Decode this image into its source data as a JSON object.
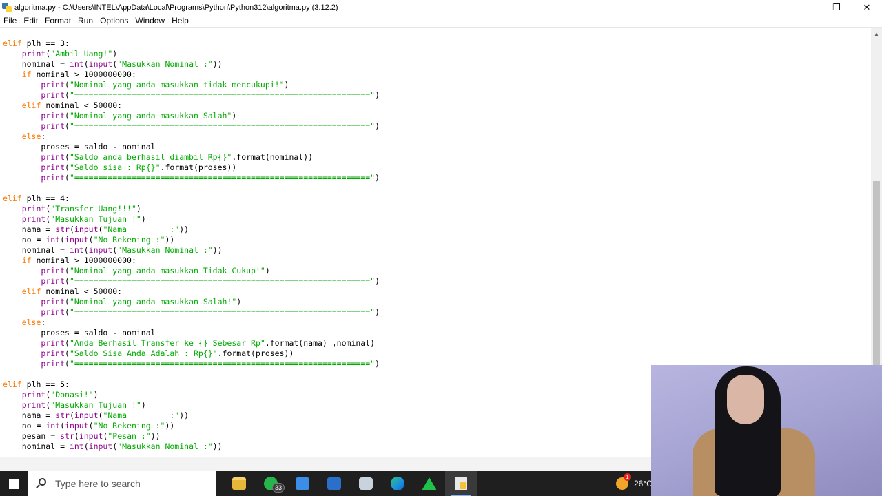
{
  "window": {
    "title": "algoritma.py - C:\\Users\\INTEL\\AppData\\Local\\Programs\\Python\\Python312\\algoritma.py (3.12.2)",
    "controls": {
      "minimize": "—",
      "restore": "❐",
      "close": "✕"
    }
  },
  "menu": {
    "items": [
      "File",
      "Edit",
      "Format",
      "Run",
      "Options",
      "Window",
      "Help"
    ]
  },
  "editor": {
    "language": "python",
    "colors": {
      "keyword": "#ff7700",
      "builtin": "#900090",
      "string": "#00aa00",
      "text": "#000000"
    },
    "lines": [
      "elif plh == 3:",
      "    print(\"Ambil Uang!\")",
      "    nominal = int(input(\"Masukkan Nominal :\"))",
      "    if nominal > 1000000000:",
      "        print(\"Nominal yang anda masukkan tidak mencukupi!\")",
      "        print(\"==============================================================\")",
      "    elif nominal < 50000:",
      "        print(\"Nominal yang anda masukkan Salah\")",
      "        print(\"==============================================================\")",
      "    else:",
      "        proses = saldo - nominal",
      "        print(\"Saldo anda berhasil diambil Rp{}\".format(nominal))",
      "        print(\"Saldo sisa : Rp{}\".format(proses))",
      "        print(\"==============================================================\")",
      "",
      "elif plh == 4:",
      "    print(\"Transfer Uang!!!\")",
      "    print(\"Masukkan Tujuan !\")",
      "    nama = str(input(\"Nama         :\"))",
      "    no = int(input(\"No Rekening :\"))",
      "    nominal = int(input(\"Masukkan Nominal :\"))",
      "    if nominal > 1000000000:",
      "        print(\"Nominal yang anda masukkan Tidak Cukup!\")",
      "        print(\"==============================================================\")",
      "    elif nominal < 50000:",
      "        print(\"Nominal yang anda masukkan Salah!\")",
      "        print(\"==============================================================\")",
      "    else:",
      "        proses = saldo - nominal",
      "        print(\"Anda Berhasil Transfer ke {} Sebesar Rp\".format(nama) ,nominal)",
      "        print(\"Saldo Sisa Anda Adalah : Rp{}\".format(proses))",
      "        print(\"==============================================================\")",
      "",
      "elif plh == 5:",
      "    print(\"Donasi!\")",
      "    print(\"Masukkan Tujuan !\")",
      "    nama = str(input(\"Nama         :\"))",
      "    no = int(input(\"No Rekening :\"))",
      "    pesan = str(input(\"Pesan :\"))",
      "    nominal = int(input(\"Masukkan Nominal :\"))"
    ]
  },
  "taskbar": {
    "search_placeholder": "Type here to search",
    "apps": [
      {
        "icon": "file-explorer-icon",
        "active": false
      },
      {
        "icon": "whatsapp-icon",
        "badge": "33",
        "active": false
      },
      {
        "icon": "microsoft-store-icon",
        "active": false
      },
      {
        "icon": "mail-icon",
        "active": false
      },
      {
        "icon": "camera-icon",
        "active": false
      },
      {
        "icon": "edge-browser-icon",
        "active": false
      },
      {
        "icon": "green-triangle-app-icon",
        "active": false
      },
      {
        "icon": "python-idle-icon",
        "active": true
      }
    ],
    "weather": {
      "temp": "26°C",
      "badge": "1"
    }
  }
}
